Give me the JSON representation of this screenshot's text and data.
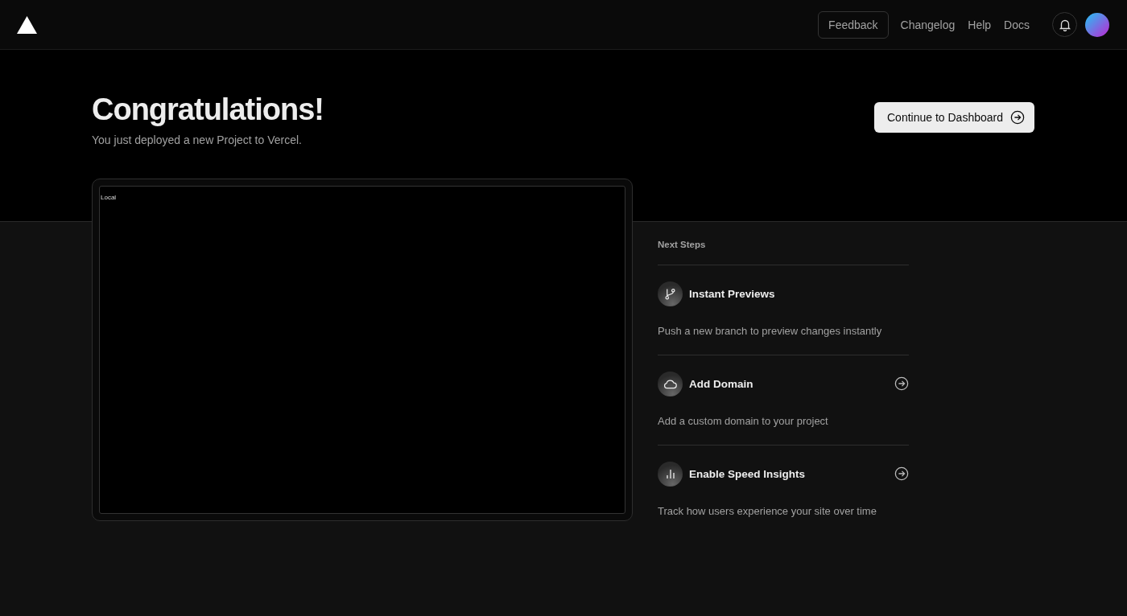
{
  "header": {
    "nav": [
      {
        "label": "Feedback",
        "kind": "outlined"
      },
      {
        "label": "Changelog",
        "kind": "link"
      },
      {
        "label": "Help",
        "kind": "link"
      },
      {
        "label": "Docs",
        "kind": "link"
      }
    ]
  },
  "hero": {
    "title": "Congratulations!",
    "subtitle": "You just deployed a new Project to Vercel.",
    "button": "Continue to Dashboard"
  },
  "preview": {
    "label": "Local"
  },
  "next_steps": {
    "heading": "Next Steps",
    "items": [
      {
        "title": "Instant Previews",
        "description": "Push a new branch to preview changes instantly",
        "kind": "branch",
        "has_arrow": false
      },
      {
        "title": "Add Domain",
        "description": "Add a custom domain to your project",
        "kind": "cloud",
        "has_arrow": true
      },
      {
        "title": "Enable Speed Insights",
        "description": "Track how users experience your site over time",
        "kind": "chart",
        "has_arrow": true
      }
    ]
  }
}
